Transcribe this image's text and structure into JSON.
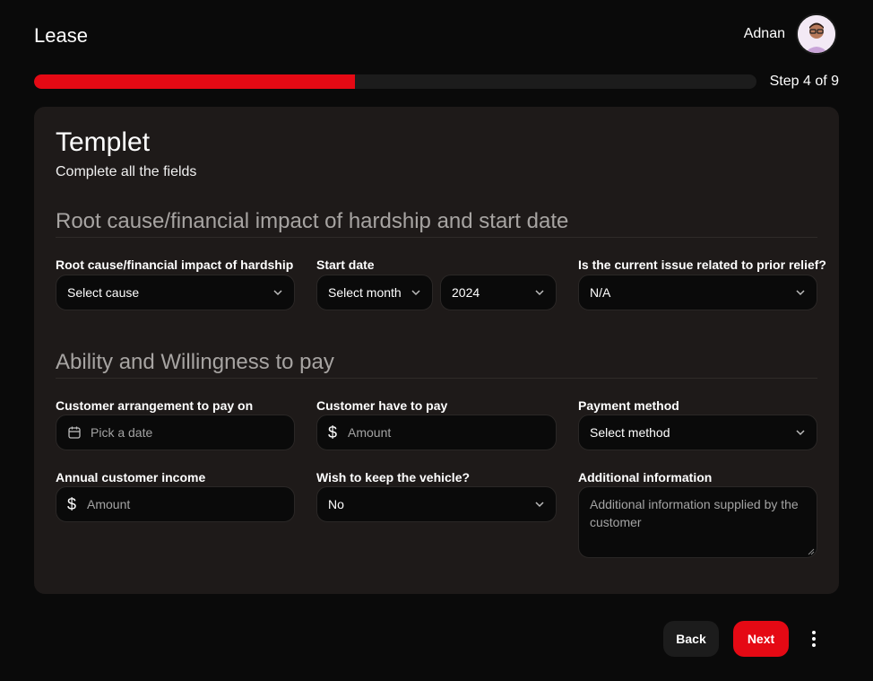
{
  "header": {
    "app_title": "Lease",
    "user_name": "Adnan"
  },
  "progress": {
    "step_label": "Step 4 of 9",
    "fraction": 0.444
  },
  "card": {
    "title": "Templet",
    "subtitle": "Complete all the fields"
  },
  "section1": {
    "title": "Root cause/financial impact of hardship and start date",
    "root_cause_label": "Root cause/financial impact of hardship",
    "root_cause_value": "Select cause",
    "start_date_label": "Start date",
    "month_value": "Select month",
    "year_value": "2024",
    "prior_relief_label": "Is the current issue related to prior relief?",
    "prior_relief_value": "N/A"
  },
  "section2": {
    "title": "Ability and Willingness to pay",
    "arrangement_label": "Customer arrangement to pay on",
    "arrangement_placeholder": "Pick a date",
    "have_to_pay_label": "Customer have to pay",
    "have_to_pay_placeholder": "Amount",
    "payment_method_label": "Payment method",
    "payment_method_value": "Select method",
    "income_label": "Annual customer income",
    "income_placeholder": "Amount",
    "keep_vehicle_label": "Wish to keep the vehicle?",
    "keep_vehicle_value": "No",
    "additional_label": "Additional information",
    "additional_placeholder": "Additional information supplied by the customer"
  },
  "footer": {
    "back_label": "Back",
    "next_label": "Next",
    "dollar_symbol": "$"
  },
  "icons": {
    "chevron": "chevron-down-icon",
    "calendar": "calendar-icon",
    "more": "more-vertical-icon",
    "avatar": "avatar"
  },
  "colors": {
    "accent": "#e50914",
    "background": "#0a0a0a",
    "card": "#1e1a19"
  }
}
